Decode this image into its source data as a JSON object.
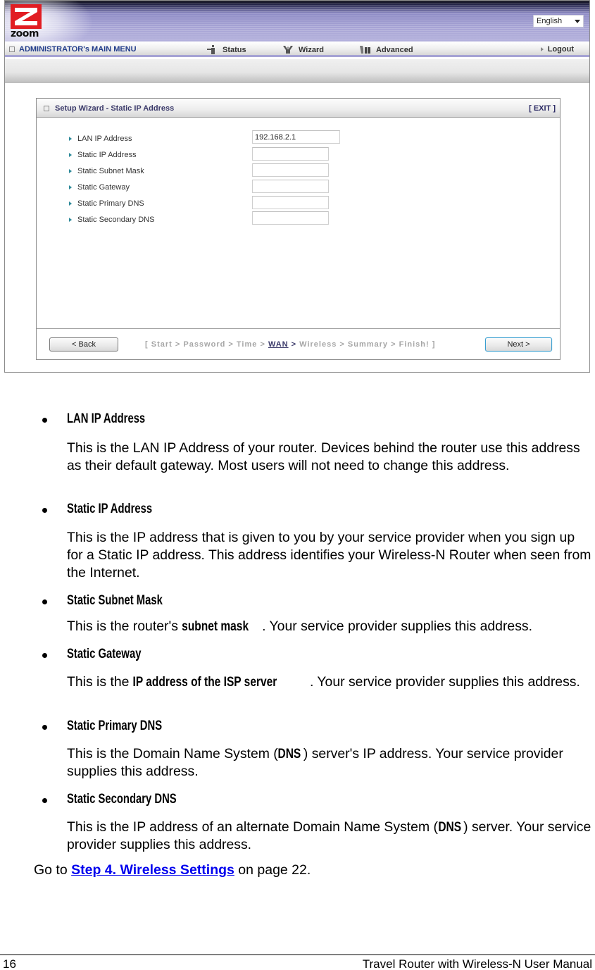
{
  "router_ui": {
    "brand": "zoom",
    "language": "English",
    "menu": {
      "admin_label": "ADMINISTRATOR's MAIN MENU",
      "status_label": "Status",
      "wizard_label": "Wizard",
      "advanced_label": "Advanced",
      "logout_label": "Logout"
    },
    "panel": {
      "title": "Setup Wizard - Static IP Address",
      "exit_label": "[ EXIT ]",
      "fields": [
        {
          "label": "LAN IP Address",
          "value": "192.168.2.1"
        },
        {
          "label": "Static IP Address",
          "value": ""
        },
        {
          "label": "Static Subnet Mask",
          "value": ""
        },
        {
          "label": "Static Gateway",
          "value": ""
        },
        {
          "label": "Static Primary DNS",
          "value": ""
        },
        {
          "label": "Static Secondary DNS",
          "value": ""
        }
      ],
      "back_label": "< Back",
      "next_label": "Next >",
      "steps": {
        "open": "[",
        "items": [
          "Start",
          "Password",
          "Time",
          "WAN",
          "Wireless",
          "Summary",
          "Finish!"
        ],
        "current": "WAN",
        "close": "]",
        "separator": ">"
      }
    }
  },
  "doc": {
    "items": [
      {
        "title": "LAN IP Address",
        "text": "This is the LAN IP Address of your router. Devices behind the router use this address as their default gateway. Most users will not need to change this address."
      },
      {
        "title": "Static IP Address",
        "text": "This is the IP address that is given to you by your service provider when you sign up for a Static IP address. This address identifies your Wireless-N Router when seen from the Internet."
      },
      {
        "title": "Static Subnet Mask",
        "text_before": "This is the router's ",
        "text_bold": "subnet mask",
        "text_after": ". Your service provider supplies this address."
      },
      {
        "title": "Static Gateway",
        "text_before": "This is the ",
        "text_bold": "IP address of the ISP server",
        "text_after": ". Your service provider supplies this address."
      },
      {
        "title": "Static Primary DNS",
        "text_before": "This is the Domain Name System (",
        "text_bold": "DNS",
        "text_after": ") server's IP address. Your service provider supplies this address."
      },
      {
        "title": "Static Secondary DNS",
        "text_before": "This is the IP address of an alternate Domain Name System (",
        "text_bold": "DNS",
        "text_after": ") server. Your service provider supplies this address."
      }
    ],
    "goto": {
      "prefix": "Go to ",
      "link": "Step 4. Wireless Settings",
      "suffix": " on page 22."
    },
    "colors": {
      "link": "#0000ee",
      "menu_accent": "#223d8a",
      "banner": "#a9a6d6",
      "next_button_border": "#3a9ed0"
    }
  },
  "footer": {
    "page_number": "16",
    "manual_title": "Travel Router with Wireless-N User Manual"
  }
}
